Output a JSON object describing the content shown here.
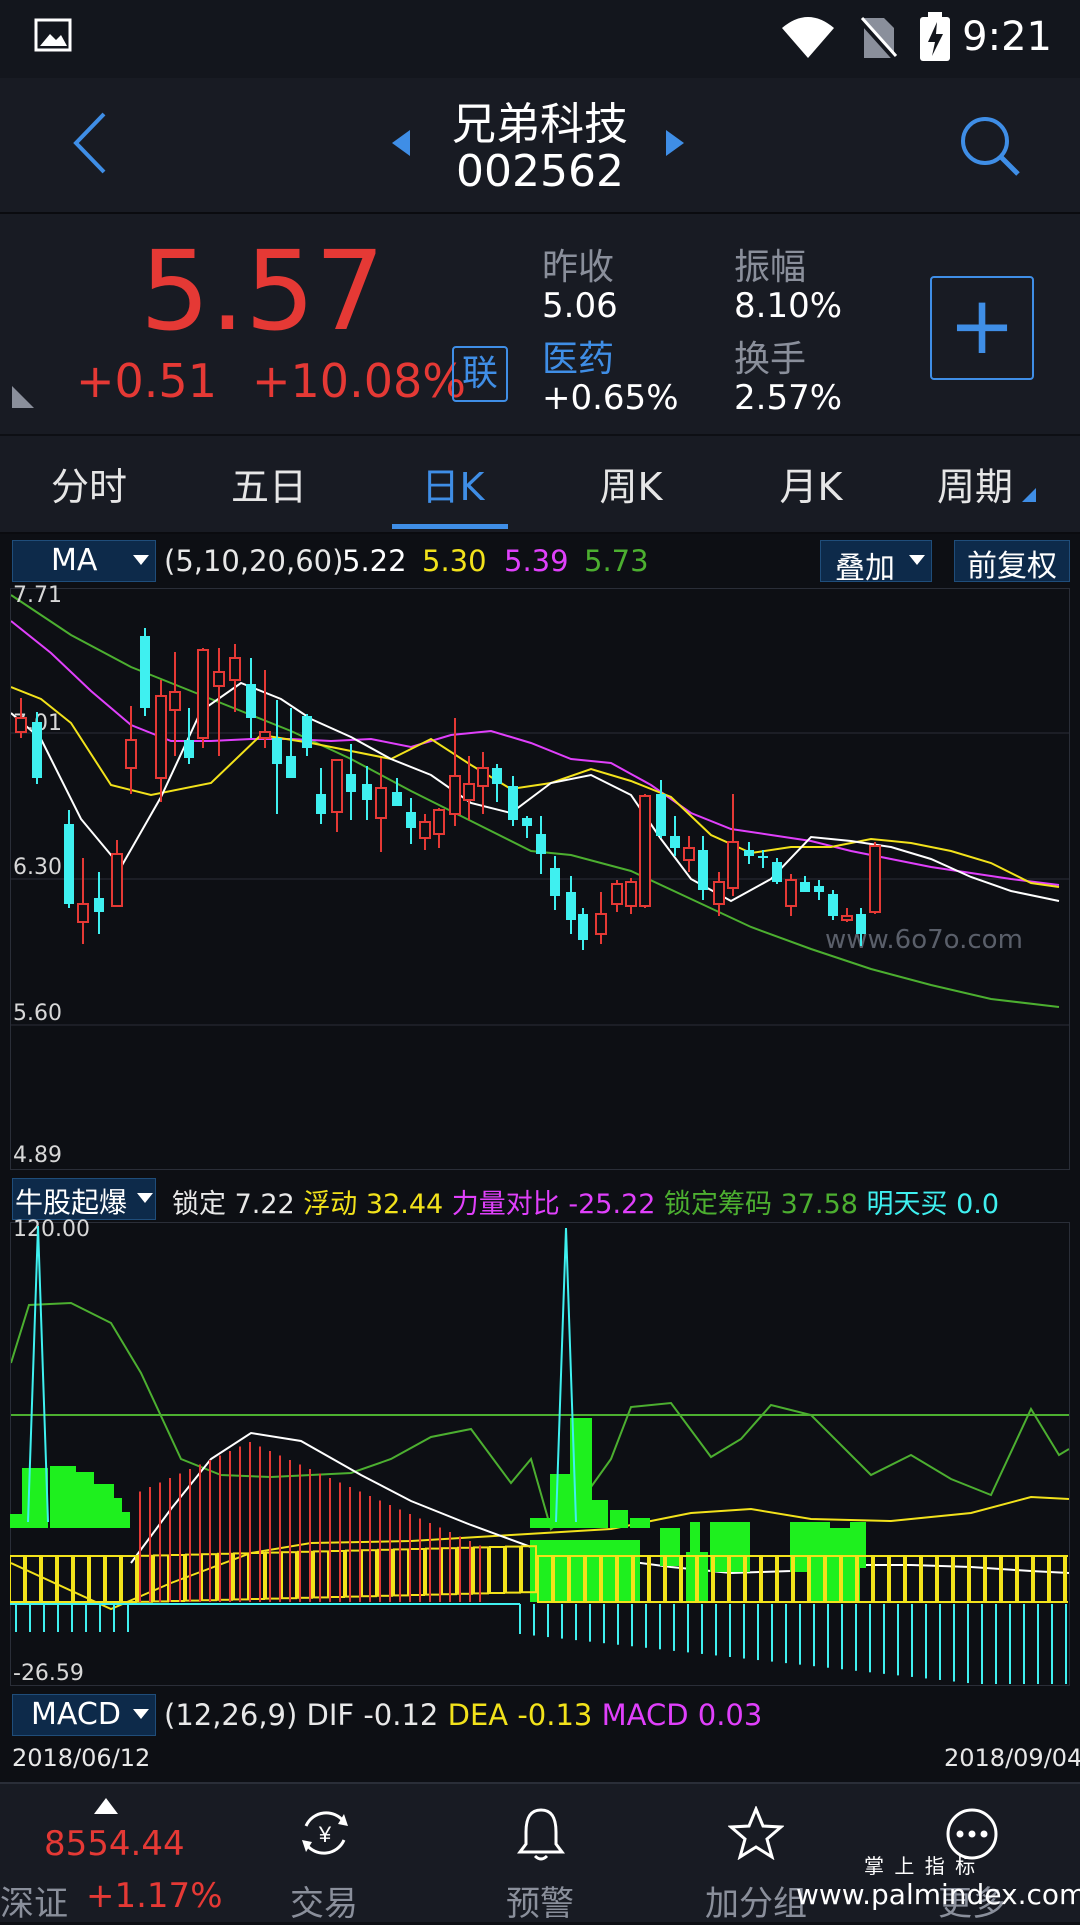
{
  "status": {
    "time": "9:21"
  },
  "header": {
    "stock_name": "兄弟科技",
    "stock_code": "002562"
  },
  "quote": {
    "price": "5.57",
    "change": "+0.51",
    "change_pct": "+10.08%",
    "lian_badge": "联",
    "prev_close_label": "昨收",
    "prev_close": "5.06",
    "amplitude_label": "振幅",
    "amplitude": "8.10%",
    "sector_label": "医药",
    "sector_change": "+0.65%",
    "turnover_label": "换手",
    "turnover": "2.57%",
    "add_button": "+"
  },
  "tabs": [
    {
      "label": "分时"
    },
    {
      "label": "五日"
    },
    {
      "label": "日K"
    },
    {
      "label": "周K"
    },
    {
      "label": "月K"
    },
    {
      "label": "周期"
    }
  ],
  "ma_bar": {
    "selector": "MA",
    "params": "(5,10,20,60)",
    "ma5": "5.22",
    "ma10": "5.30",
    "ma20": "5.39",
    "ma60": "5.73",
    "overlay": "叠加",
    "adjust": "前复权"
  },
  "kline_axis": {
    "y_top": "7.71",
    "y_2": "7.01",
    "y_3": "6.30",
    "y_4": "5.60",
    "y_bottom": "4.89"
  },
  "watermark": "www.6o7o.com",
  "indicator_bar": {
    "selector": "牛股起爆",
    "lock_label": "锁定",
    "lock_value": "7.22",
    "float_label": "浮动",
    "float_value": "32.44",
    "force_label": "力量对比",
    "force_value": "-25.22",
    "lockchip_label": "锁定筹码",
    "lockchip_value": "37.58",
    "buy_label": "明天买",
    "buy_value": "0.0"
  },
  "indicator_axis": {
    "y_top": "120.00",
    "y_bottom": "-26.59"
  },
  "macd_bar": {
    "selector": "MACD",
    "params": "(12,26,9)",
    "dif_label": "DIF",
    "dif_value": "-0.12",
    "dea_label": "DEA",
    "dea_value": "-0.13",
    "macd_label": "MACD",
    "macd_value": "0.03"
  },
  "dates": {
    "start": "2018/06/12",
    "end": "2018/09/04"
  },
  "bottom_nav": {
    "index_value": "8554.44",
    "index_name": "深证",
    "index_change": "+1.17%",
    "items": [
      {
        "label": "交易"
      },
      {
        "label": "预警"
      },
      {
        "label": "加分组"
      },
      {
        "label": "更多"
      }
    ]
  },
  "footer_watermark": {
    "line1": "掌 上 指 标",
    "line2": "www.palmindex.com"
  },
  "colors": {
    "up": "#e53935",
    "down": "#3ff0f0",
    "ma5": "#ffffff",
    "ma10": "#f2e21b",
    "ma20": "#e040fb",
    "ma60": "#4caf30",
    "accent": "#3f8ee6"
  }
}
